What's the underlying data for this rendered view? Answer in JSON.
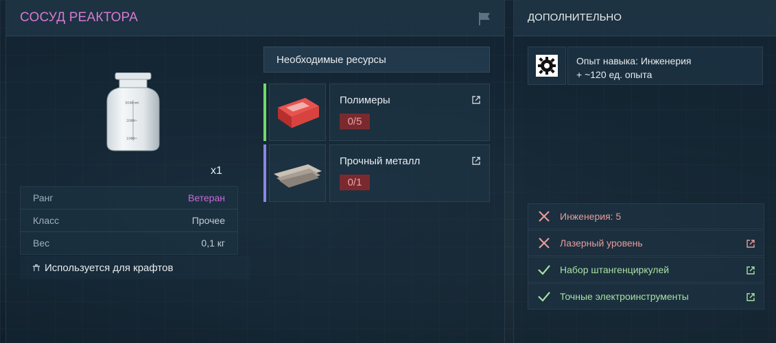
{
  "item": {
    "title": "СОСУД РЕАКТОРА",
    "quantity": "x1",
    "stats": [
      {
        "label": "Ранг",
        "value": "Ветеран"
      },
      {
        "label": "Класс",
        "value": "Прочее"
      },
      {
        "label": "Вес",
        "value": "0,1 кг"
      }
    ],
    "crafts_label": "Используется для крафтов",
    "jar_marks": [
      "3000 ml",
      "2000",
      "1000"
    ]
  },
  "resources": {
    "header": "Необходимые ресурсы",
    "items": [
      {
        "name": "Полимеры",
        "count": "0/5",
        "bar_color": "#6fdc6a"
      },
      {
        "name": "Прочный металл",
        "count": "0/1",
        "bar_color": "#8c86e6"
      }
    ]
  },
  "additional": {
    "title": "ДОПОЛНИТЕЛЬНО",
    "xp_line1": "Опыт навыка: Инженерия",
    "xp_line2": "+ ~120 ед. опыта",
    "requirements": [
      {
        "label": "Инженерия: 5",
        "status": "missing",
        "has_link": false
      },
      {
        "label": "Лазерный уровень",
        "status": "missing",
        "has_link": true
      },
      {
        "label": "Набор штангенциркулей",
        "status": "met",
        "has_link": true
      },
      {
        "label": "Точные электроинструменты",
        "status": "met",
        "has_link": true
      }
    ]
  },
  "colors": {
    "title": "#d77ad1",
    "rank": "#c96ad9",
    "count_bg": "#7a2a2e",
    "missing": "#e89d9a",
    "met": "#a8e2a4"
  },
  "icons": [
    "flag-icon",
    "gear-icon",
    "cross-icon",
    "check-icon",
    "external-link-icon",
    "workbench-icon"
  ]
}
